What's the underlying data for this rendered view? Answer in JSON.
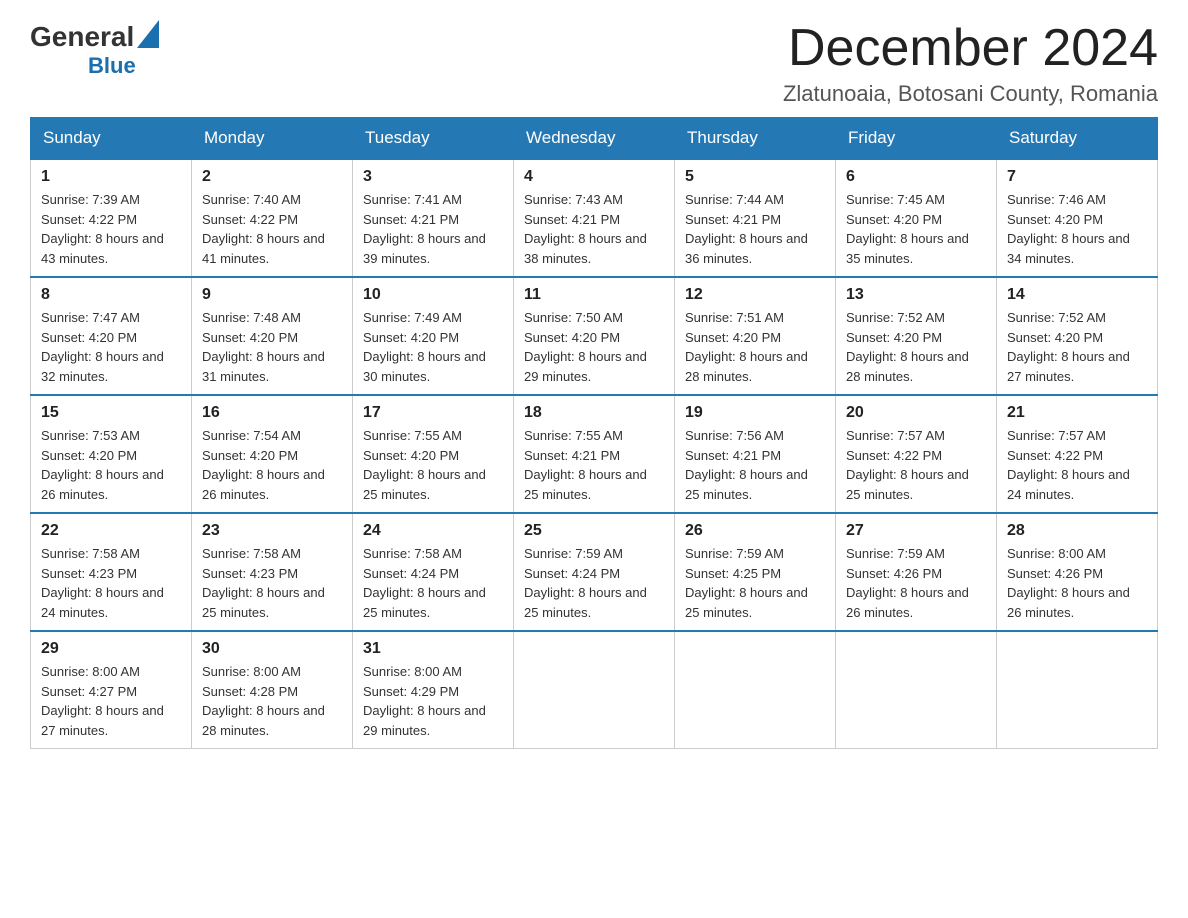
{
  "header": {
    "logo": {
      "general": "General",
      "blue": "Blue"
    },
    "title": "December 2024",
    "location": "Zlatunoaia, Botosani County, Romania"
  },
  "calendar": {
    "days_of_week": [
      "Sunday",
      "Monday",
      "Tuesday",
      "Wednesday",
      "Thursday",
      "Friday",
      "Saturday"
    ],
    "weeks": [
      [
        {
          "day": "1",
          "sunrise": "Sunrise: 7:39 AM",
          "sunset": "Sunset: 4:22 PM",
          "daylight": "Daylight: 8 hours and 43 minutes."
        },
        {
          "day": "2",
          "sunrise": "Sunrise: 7:40 AM",
          "sunset": "Sunset: 4:22 PM",
          "daylight": "Daylight: 8 hours and 41 minutes."
        },
        {
          "day": "3",
          "sunrise": "Sunrise: 7:41 AM",
          "sunset": "Sunset: 4:21 PM",
          "daylight": "Daylight: 8 hours and 39 minutes."
        },
        {
          "day": "4",
          "sunrise": "Sunrise: 7:43 AM",
          "sunset": "Sunset: 4:21 PM",
          "daylight": "Daylight: 8 hours and 38 minutes."
        },
        {
          "day": "5",
          "sunrise": "Sunrise: 7:44 AM",
          "sunset": "Sunset: 4:21 PM",
          "daylight": "Daylight: 8 hours and 36 minutes."
        },
        {
          "day": "6",
          "sunrise": "Sunrise: 7:45 AM",
          "sunset": "Sunset: 4:20 PM",
          "daylight": "Daylight: 8 hours and 35 minutes."
        },
        {
          "day": "7",
          "sunrise": "Sunrise: 7:46 AM",
          "sunset": "Sunset: 4:20 PM",
          "daylight": "Daylight: 8 hours and 34 minutes."
        }
      ],
      [
        {
          "day": "8",
          "sunrise": "Sunrise: 7:47 AM",
          "sunset": "Sunset: 4:20 PM",
          "daylight": "Daylight: 8 hours and 32 minutes."
        },
        {
          "day": "9",
          "sunrise": "Sunrise: 7:48 AM",
          "sunset": "Sunset: 4:20 PM",
          "daylight": "Daylight: 8 hours and 31 minutes."
        },
        {
          "day": "10",
          "sunrise": "Sunrise: 7:49 AM",
          "sunset": "Sunset: 4:20 PM",
          "daylight": "Daylight: 8 hours and 30 minutes."
        },
        {
          "day": "11",
          "sunrise": "Sunrise: 7:50 AM",
          "sunset": "Sunset: 4:20 PM",
          "daylight": "Daylight: 8 hours and 29 minutes."
        },
        {
          "day": "12",
          "sunrise": "Sunrise: 7:51 AM",
          "sunset": "Sunset: 4:20 PM",
          "daylight": "Daylight: 8 hours and 28 minutes."
        },
        {
          "day": "13",
          "sunrise": "Sunrise: 7:52 AM",
          "sunset": "Sunset: 4:20 PM",
          "daylight": "Daylight: 8 hours and 28 minutes."
        },
        {
          "day": "14",
          "sunrise": "Sunrise: 7:52 AM",
          "sunset": "Sunset: 4:20 PM",
          "daylight": "Daylight: 8 hours and 27 minutes."
        }
      ],
      [
        {
          "day": "15",
          "sunrise": "Sunrise: 7:53 AM",
          "sunset": "Sunset: 4:20 PM",
          "daylight": "Daylight: 8 hours and 26 minutes."
        },
        {
          "day": "16",
          "sunrise": "Sunrise: 7:54 AM",
          "sunset": "Sunset: 4:20 PM",
          "daylight": "Daylight: 8 hours and 26 minutes."
        },
        {
          "day": "17",
          "sunrise": "Sunrise: 7:55 AM",
          "sunset": "Sunset: 4:20 PM",
          "daylight": "Daylight: 8 hours and 25 minutes."
        },
        {
          "day": "18",
          "sunrise": "Sunrise: 7:55 AM",
          "sunset": "Sunset: 4:21 PM",
          "daylight": "Daylight: 8 hours and 25 minutes."
        },
        {
          "day": "19",
          "sunrise": "Sunrise: 7:56 AM",
          "sunset": "Sunset: 4:21 PM",
          "daylight": "Daylight: 8 hours and 25 minutes."
        },
        {
          "day": "20",
          "sunrise": "Sunrise: 7:57 AM",
          "sunset": "Sunset: 4:22 PM",
          "daylight": "Daylight: 8 hours and 25 minutes."
        },
        {
          "day": "21",
          "sunrise": "Sunrise: 7:57 AM",
          "sunset": "Sunset: 4:22 PM",
          "daylight": "Daylight: 8 hours and 24 minutes."
        }
      ],
      [
        {
          "day": "22",
          "sunrise": "Sunrise: 7:58 AM",
          "sunset": "Sunset: 4:23 PM",
          "daylight": "Daylight: 8 hours and 24 minutes."
        },
        {
          "day": "23",
          "sunrise": "Sunrise: 7:58 AM",
          "sunset": "Sunset: 4:23 PM",
          "daylight": "Daylight: 8 hours and 25 minutes."
        },
        {
          "day": "24",
          "sunrise": "Sunrise: 7:58 AM",
          "sunset": "Sunset: 4:24 PM",
          "daylight": "Daylight: 8 hours and 25 minutes."
        },
        {
          "day": "25",
          "sunrise": "Sunrise: 7:59 AM",
          "sunset": "Sunset: 4:24 PM",
          "daylight": "Daylight: 8 hours and 25 minutes."
        },
        {
          "day": "26",
          "sunrise": "Sunrise: 7:59 AM",
          "sunset": "Sunset: 4:25 PM",
          "daylight": "Daylight: 8 hours and 25 minutes."
        },
        {
          "day": "27",
          "sunrise": "Sunrise: 7:59 AM",
          "sunset": "Sunset: 4:26 PM",
          "daylight": "Daylight: 8 hours and 26 minutes."
        },
        {
          "day": "28",
          "sunrise": "Sunrise: 8:00 AM",
          "sunset": "Sunset: 4:26 PM",
          "daylight": "Daylight: 8 hours and 26 minutes."
        }
      ],
      [
        {
          "day": "29",
          "sunrise": "Sunrise: 8:00 AM",
          "sunset": "Sunset: 4:27 PM",
          "daylight": "Daylight: 8 hours and 27 minutes."
        },
        {
          "day": "30",
          "sunrise": "Sunrise: 8:00 AM",
          "sunset": "Sunset: 4:28 PM",
          "daylight": "Daylight: 8 hours and 28 minutes."
        },
        {
          "day": "31",
          "sunrise": "Sunrise: 8:00 AM",
          "sunset": "Sunset: 4:29 PM",
          "daylight": "Daylight: 8 hours and 29 minutes."
        },
        null,
        null,
        null,
        null
      ]
    ]
  }
}
